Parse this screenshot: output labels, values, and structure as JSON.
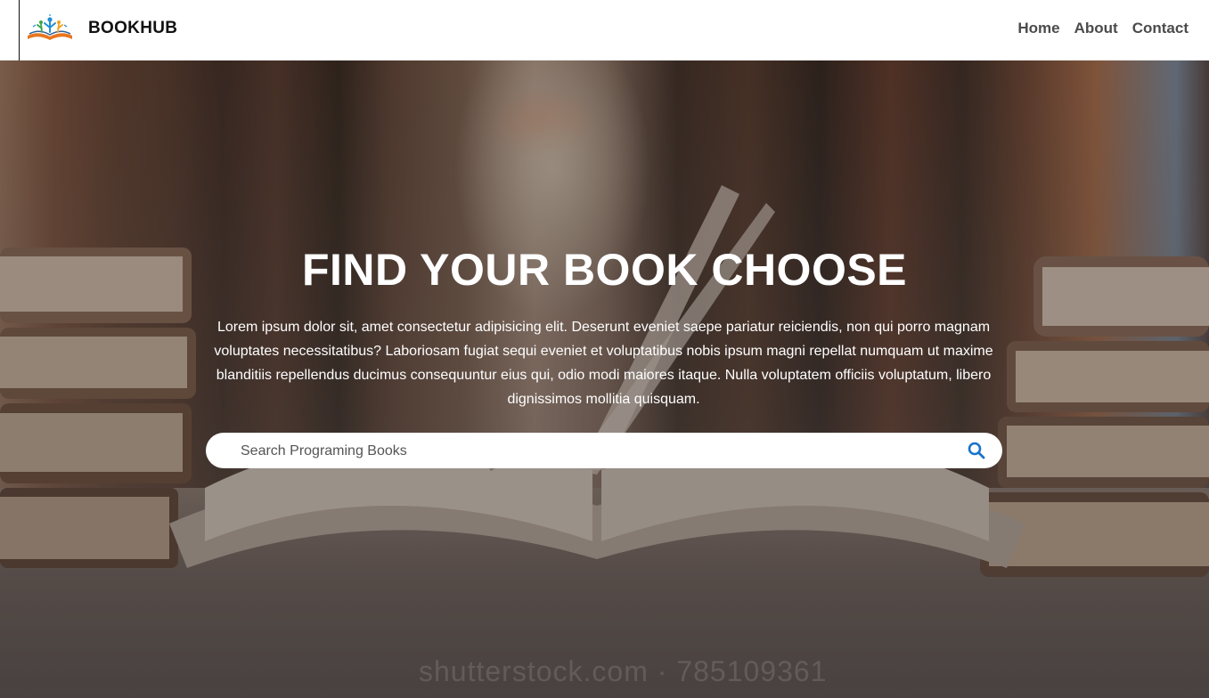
{
  "navbar": {
    "brand": "BOOKHUB",
    "links": [
      {
        "label": "Home"
      },
      {
        "label": "About"
      },
      {
        "label": "Contact"
      }
    ]
  },
  "hero": {
    "title": "FIND YOUR BOOK CHOOSE",
    "description": "Lorem ipsum dolor sit, amet consectetur adipisicing elit. Deserunt eveniet saepe pariatur reiciendis, non qui porro magnam voluptates necessitatibus? Laboriosam fugiat sequi eveniet et voluptatibus nobis ipsum magni repellat numquam ut maxime blanditiis repellendus ducimus consequuntur eius qui, odio modi maiores itaque. Nulla voluptatem officiis voluptatum, libero dignissimos mollitia quisquam.",
    "search": {
      "placeholder": "Search Programing Books",
      "value": "",
      "icon": "search-icon"
    },
    "watermark": "shutterstock.com · 785109361"
  },
  "colors": {
    "accent": "#1a73c9",
    "navbar_bg": "#ffffff",
    "nav_link": "#4b4b4b"
  }
}
